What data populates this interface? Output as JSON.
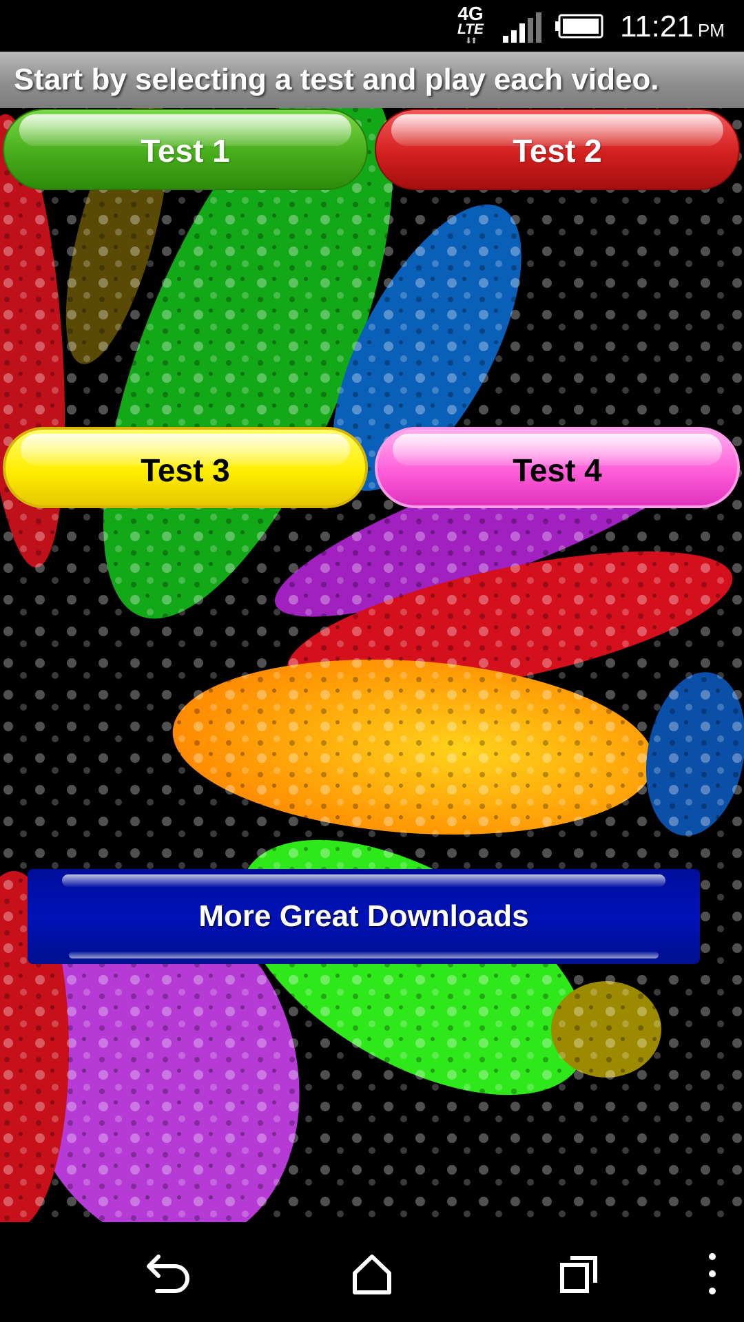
{
  "status_bar": {
    "network_type": "4G",
    "network_subtype": "LTE",
    "time": "11:21",
    "ampm": "PM",
    "icons": [
      "network-4g-lte-icon",
      "signal-icon",
      "battery-icon"
    ]
  },
  "banner": {
    "text": "Start by selecting a test and play each video."
  },
  "tests": {
    "test1": {
      "label": "Test 1",
      "color": "#47ad1a"
    },
    "test2": {
      "label": "Test 2",
      "color": "#d31f1f"
    },
    "test3": {
      "label": "Test 3",
      "color": "#ffee00"
    },
    "test4": {
      "label": "Test 4",
      "color": "#ff5ed9"
    }
  },
  "more_downloads": {
    "label": "More Great Downloads",
    "color": "#0012b8"
  },
  "nav_bar": {
    "icons": [
      "back-icon",
      "home-icon",
      "recents-icon",
      "overflow-menu-icon"
    ]
  }
}
